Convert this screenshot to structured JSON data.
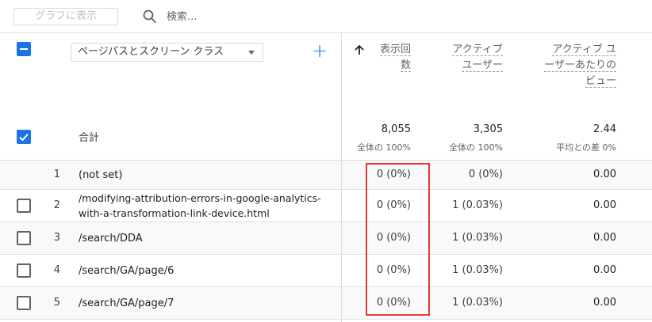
{
  "toolbar": {
    "chart_button": "グラフに表示",
    "search_placeholder": "検索..."
  },
  "header": {
    "dimension_select": "ページパスとスクリーン クラス",
    "col_views_line1": "表示回",
    "col_views_line2": "数",
    "col_users_line1": "アクティブ",
    "col_users_line2": "ユーザー",
    "col_vpu_line1": "アクティブ ユ",
    "col_vpu_line2": "ーザーあたりの",
    "col_vpu_line3": "ビュー"
  },
  "totals": {
    "label": "合計",
    "views": "8,055",
    "views_sub": "全体の 100%",
    "users": "3,305",
    "users_sub": "全体の 100%",
    "vpu": "2.44",
    "vpu_sub": "平均との差 0%"
  },
  "rows": [
    {
      "num": "1",
      "page": "(not set)",
      "views": "0 (0%)",
      "users": "0 (0%)",
      "vpu": "0.00"
    },
    {
      "num": "2",
      "page": "/modifying-attribution-errors-in-google-analytics-with-a-transformation-link-device.html",
      "views": "0 (0%)",
      "users": "1 (0.03%)",
      "vpu": "0.00"
    },
    {
      "num": "3",
      "page": "/search/DDA",
      "views": "0 (0%)",
      "users": "1 (0.03%)",
      "vpu": "0.00"
    },
    {
      "num": "4",
      "page": "/search/GA/page/6",
      "views": "0 (0%)",
      "users": "1 (0.03%)",
      "vpu": "0.00"
    },
    {
      "num": "5",
      "page": "/search/GA/page/7",
      "views": "0 (0%)",
      "users": "1 (0.03%)",
      "vpu": "0.00"
    }
  ],
  "colors": {
    "accent": "#1a73e8",
    "highlight": "#e53935"
  }
}
